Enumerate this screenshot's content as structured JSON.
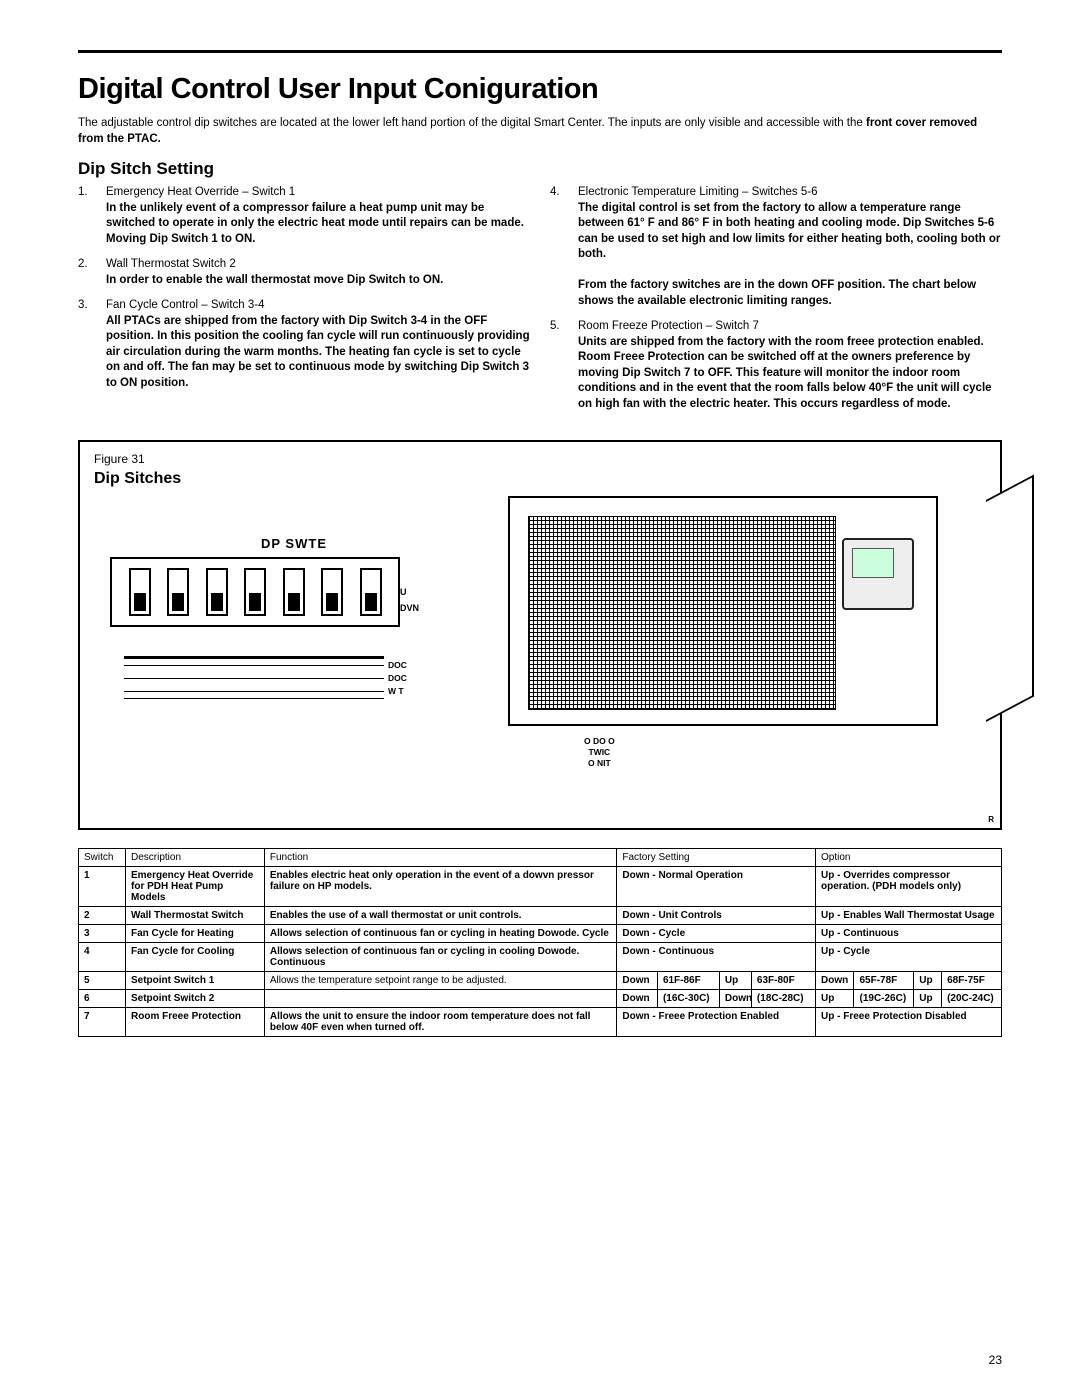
{
  "page_number": "23",
  "title": "Digital Control User Input Coniguration",
  "intro_plain": "The adjustable control dip switches are located at the lower left hand portion of the digital Smart Center. The inputs are only visible and accessible with the ",
  "intro_bold": "front cover removed from the PTAC.",
  "section_heading": "Dip Sitch Setting",
  "left_items": [
    {
      "num": "1.",
      "title": "Emergency Heat Override – Switch 1",
      "text": "In the unlikely event of a compressor failure a heat pump unit may be switched to operate in only the electric heat mode until repairs can be made. Moving Dip Switch 1 to ON."
    },
    {
      "num": "2.",
      "title": "Wall Thermostat Switch 2",
      "text": "In order to enable the wall thermostat move Dip Switch to ON."
    },
    {
      "num": "3.",
      "title": "Fan Cycle Control – Switch 3-4",
      "text": "All PTACs are shipped from the factory with Dip Switch 3-4 in the OFF position.  In this position the cooling fan cycle will run continuously providing air circulation during the warm months. The heating fan cycle is set to cycle on and off.  The fan may be set to continuous mode by switching Dip Switch 3 to ON position."
    }
  ],
  "right_items": [
    {
      "num": "4.",
      "title": "Electronic Temperature Limiting – Switches 5-6",
      "text": "The digital control is set from the factory to allow a temperature range between 61° F and 86° F in both heating and cooling mode. Dip Switches 5-6 can be used to set high and low limits for either heating both, cooling both or both.",
      "text2": "From the factory switches are in the down OFF position. The chart below shows the available electronic limiting ranges."
    },
    {
      "num": "5.",
      "title": "Room Freeze Protection – Switch 7",
      "text": "Units are shipped from the factory with the room freee protection enabled.  Room Freee Protection can be switched off at the owners preference by moving Dip Switch 7 to OFF. This feature will monitor the indoor room conditions and in the event that the room falls below 40°F the unit will cycle on high fan with the electric heater. This occurs regardless of mode."
    }
  ],
  "figure": {
    "label": "Figure  31",
    "heading": "Dip Sitches",
    "dip_title": "DP SWTE",
    "up": "U",
    "down": "DVN",
    "rev": "R",
    "leads": [
      "",
      "",
      "",
      "DOC",
      "DOC",
      "W  T",
      ""
    ],
    "unit_note_l1": "O   DO O",
    "unit_note_l2": "TWIC",
    "unit_note_l3": "O NIT"
  },
  "table": {
    "headers": [
      "Switch",
      "Description",
      "Function",
      "Factory Setting",
      "Option"
    ],
    "rows": [
      {
        "sw": "1",
        "desc": "Emergency Heat Override for PDH Heat Pump Models",
        "func": "Enables electric heat only operation in the event of a dowvn pressor failure on HP models.",
        "fs": "Down - Normal Operation",
        "opt": "Up - Overrides compressor operation. (PDH models only)"
      },
      {
        "sw": "2",
        "desc": "Wall Thermostat Switch",
        "func": "Enables the use of a wall thermostat or unit controls.",
        "fs": "Down - Unit Controls",
        "opt": "Up - Enables Wall Thermostat Usage"
      },
      {
        "sw": "3",
        "desc": "Fan Cycle for Heating",
        "func": "Allows selection of continuous fan or cycling in heating Dowode. Cycle",
        "fs": "Down - Cycle",
        "opt": "Up - Continuous"
      },
      {
        "sw": "4",
        "desc": "Fan Cycle for Cooling",
        "func": "Allows selection of continuous fan or cycling in cooling Dowode. Continuous",
        "fs": "Down - Continuous",
        "opt": "Up - Cycle"
      },
      {
        "sw": "5",
        "desc": "Setpoint Switch 1",
        "func_plain": "Allows the temperature setpoint range to be adjusted.",
        "fs_a": "Down",
        "fs_b": "61F-86F",
        "fs_c": "Up",
        "fs_d": "63F-80F",
        "opt_a": "Down",
        "opt_b": "65F-78F",
        "opt_c": "Up",
        "opt_d": "68F-75F"
      },
      {
        "sw": "6",
        "desc": "Setpoint Switch 2",
        "func_plain": "",
        "fs_a": "Down",
        "fs_b": "(16C-30C)",
        "fs_c": "Down",
        "fs_d": "(18C-28C)",
        "opt_a": "Up",
        "opt_b": "(19C-26C)",
        "opt_c": "Up",
        "opt_d": "(20C-24C)"
      },
      {
        "sw": "7",
        "desc": "Room Freee Protection",
        "func": "Allows the unit to ensure the indoor room temperature does not fall below 40F even when turned off.",
        "fs": "Down - Freee Protection Enabled",
        "opt": "Up - Freee Protection Disabled"
      }
    ]
  }
}
